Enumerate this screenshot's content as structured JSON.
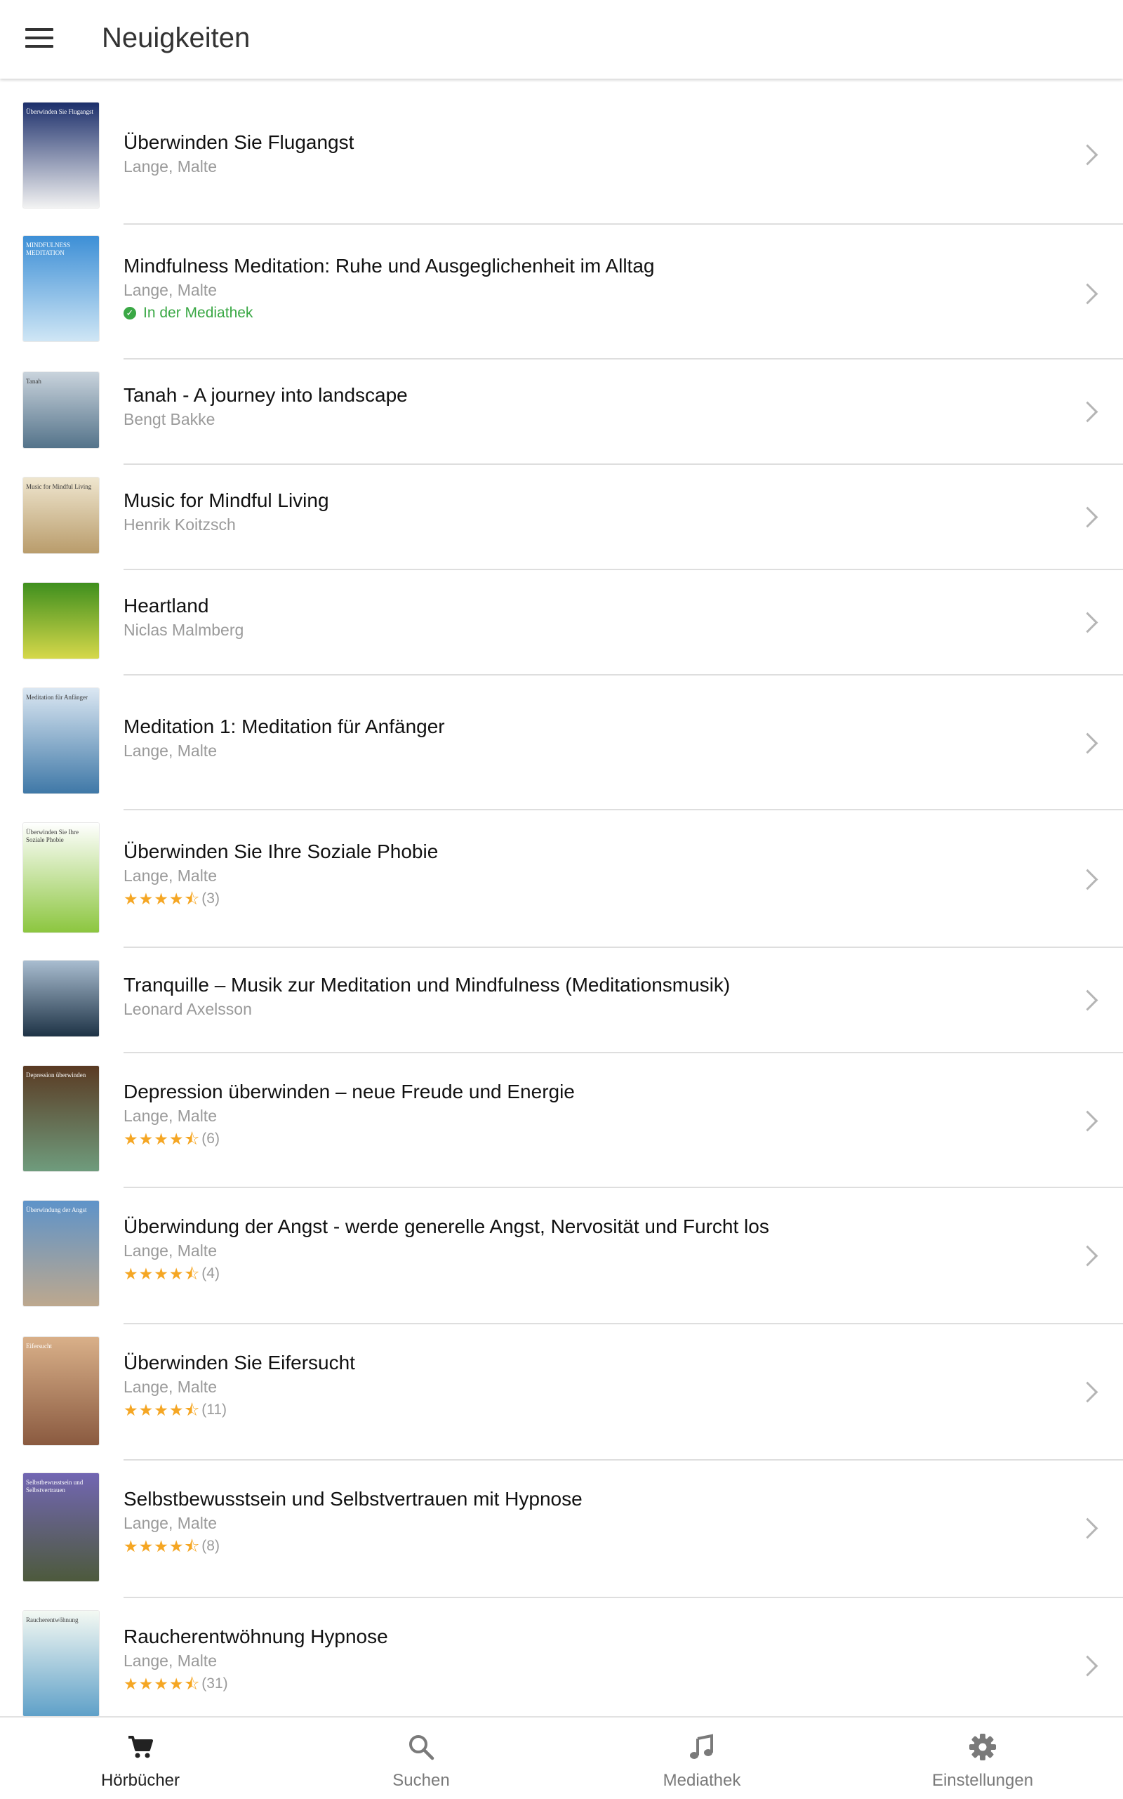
{
  "header": {
    "title": "Neuigkeiten",
    "menu_icon": "hamburger-menu-icon"
  },
  "items": [
    {
      "title": "Überwinden Sie Flugangst",
      "author": "Lange, Malte",
      "cover_text": "Überwinden Sie Flugangst",
      "cover_colors": [
        "#1c2f6b",
        "#f2f2f2"
      ]
    },
    {
      "title": "Mindfulness Meditation: Ruhe und Ausgeglichenheit im Alltag",
      "author": "Lange, Malte",
      "badge": "In der Mediathek",
      "cover_text": "MINDFULNESS MEDITATION",
      "cover_colors": [
        "#3d8fd6",
        "#cfe6f5"
      ]
    },
    {
      "title": "Tanah - A journey into landscape",
      "author": "Bengt Bakke",
      "cover_text": "Tanah",
      "cover_colors": [
        "#c9d3dc",
        "#54738a"
      ]
    },
    {
      "title": "Music for Mindful Living",
      "author": "Henrik Koitzsch",
      "cover_text": "Music for Mindful Living",
      "cover_colors": [
        "#efe6cf",
        "#b99c6b"
      ]
    },
    {
      "title": "Heartland",
      "author": "Niclas Malmberg",
      "cover_text": "",
      "cover_colors": [
        "#3f8f1e",
        "#d6d84a"
      ]
    },
    {
      "title": "Meditation 1: Meditation für Anfänger",
      "author": "Lange, Malte",
      "cover_text": "Meditation für Anfänger",
      "cover_colors": [
        "#dbe7f2",
        "#3f78a7"
      ]
    },
    {
      "title": "Überwinden Sie Ihre Soziale Phobie",
      "author": "Lange, Malte",
      "stars": "★★★★⯪",
      "count": "(3)",
      "cover_text": "Überwinden Sie Ihre Soziale Phobie",
      "cover_colors": [
        "#ffffff",
        "#8cc63f"
      ]
    },
    {
      "title": "Tranquille – Musik zur Meditation und Mindfulness (Meditationsmusik)",
      "author": "Leonard Axelsson",
      "cover_text": "",
      "cover_colors": [
        "#a9bdd0",
        "#1e3346"
      ]
    },
    {
      "title": "Depression überwinden – neue Freude und Energie",
      "author": "Lange, Malte",
      "stars": "★★★★⯪",
      "count": "(6)",
      "cover_text": "Depression überwinden",
      "cover_colors": [
        "#5a3a23",
        "#6f9c7d"
      ]
    },
    {
      "title": "Überwindung der Angst - werde generelle Angst, Nervosität und Furcht los",
      "author": "Lange, Malte",
      "stars": "★★★★⯪",
      "count": "(4)",
      "cover_text": "Überwindung der Angst",
      "cover_colors": [
        "#5e93c9",
        "#bda88e"
      ]
    },
    {
      "title": "Überwinden Sie Eifersucht",
      "author": "Lange, Malte",
      "stars": "★★★★⯪",
      "count": "(11)",
      "cover_text": "Eifersucht",
      "cover_colors": [
        "#d9b089",
        "#8a5a40"
      ]
    },
    {
      "title": "Selbstbewusstsein und Selbstvertrauen mit Hypnose",
      "author": "Lange, Malte",
      "stars": "★★★★⯪",
      "count": "(8)",
      "cover_text": "Selbstbewusstsein und Selbstvertrauen",
      "cover_colors": [
        "#7266b3",
        "#4d5a3c"
      ]
    },
    {
      "title": "Raucherentwöhnung Hypnose",
      "author": "Lange, Malte",
      "stars": "★★★★⯪",
      "count": "(31)",
      "cover_text": "Raucherentwöhnung",
      "cover_colors": [
        "#f4f9f3",
        "#5fa0c8"
      ]
    }
  ],
  "tabs": [
    {
      "label": "Hörbücher",
      "icon": "cart-icon",
      "active": true
    },
    {
      "label": "Suchen",
      "icon": "search-icon",
      "active": false
    },
    {
      "label": "Mediathek",
      "icon": "music-note-icon",
      "active": false
    },
    {
      "label": "Einstellungen",
      "icon": "gear-icon",
      "active": false
    }
  ],
  "colors": {
    "accent_green": "#3aa845",
    "star": "#f5a623",
    "secondary_text": "#9a9a9a"
  }
}
